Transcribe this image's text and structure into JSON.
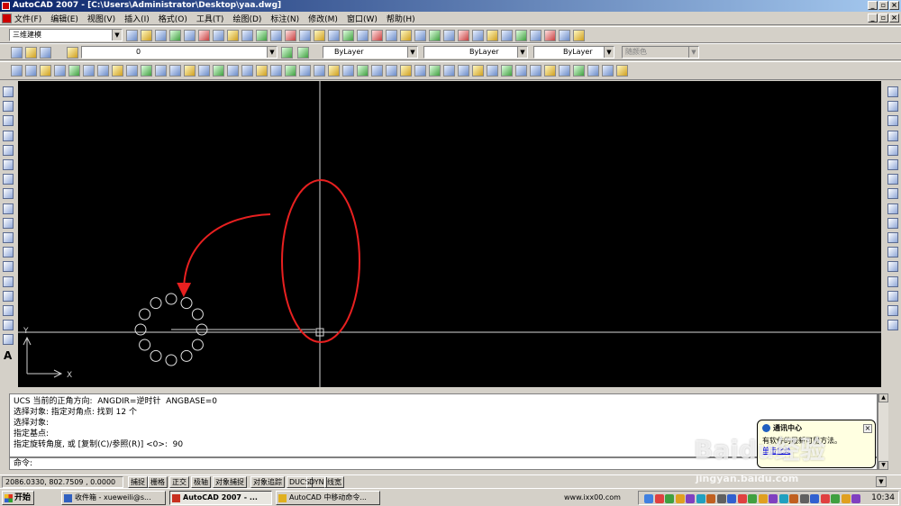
{
  "window": {
    "title": "AutoCAD 2007 - [C:\\Users\\Administrator\\Desktop\\yaa.dwg]"
  },
  "menu": {
    "items": [
      "文件(F)",
      "编辑(E)",
      "视图(V)",
      "插入(I)",
      "格式(O)",
      "工具(T)",
      "绘图(D)",
      "标注(N)",
      "修改(M)",
      "窗口(W)",
      "帮助(H)"
    ]
  },
  "toolbars": {
    "workspace": "三维建模",
    "layer": "0",
    "color": "ByLayer",
    "linetype": "ByLayer",
    "lineweight": "ByLayer",
    "plotstyle": "随颜色"
  },
  "canvas": {
    "ucs_y": "Y",
    "ucs_x": "X",
    "annotation_color": "#e82020"
  },
  "command": {
    "history": [
      "UCS 当前的正角方向:  ANGDIR=逆时针  ANGBASE=0",
      "选择对象: 指定对角点: 找到 12 个",
      "选择对象:",
      "指定基点:",
      "指定旋转角度, 或 [复制(C)/参照(R)] <0>:  90"
    ],
    "prompt": "命令:"
  },
  "status": {
    "coords": "2086.0330, 802.7509 , 0.0000",
    "buttons": [
      "捕捉",
      "栅格",
      "正交",
      "极轴",
      "对象捕捉",
      "对象追踪",
      "DUCS",
      "DYN",
      "线宽"
    ]
  },
  "taskbar": {
    "start": "开始",
    "tasks": [
      "收件箱 - xueweili@s...",
      "AutoCAD 2007 - ...",
      "AutoCAD 中移动命令..."
    ],
    "url_text": "www.ixx00.com",
    "time": "10:34"
  },
  "balloon": {
    "title": "通讯中心",
    "text": "有软件的最新可用方法。",
    "link": "单击此处"
  },
  "watermark": {
    "text": "Baidu经验",
    "url": "jingyan.baidu.com"
  }
}
